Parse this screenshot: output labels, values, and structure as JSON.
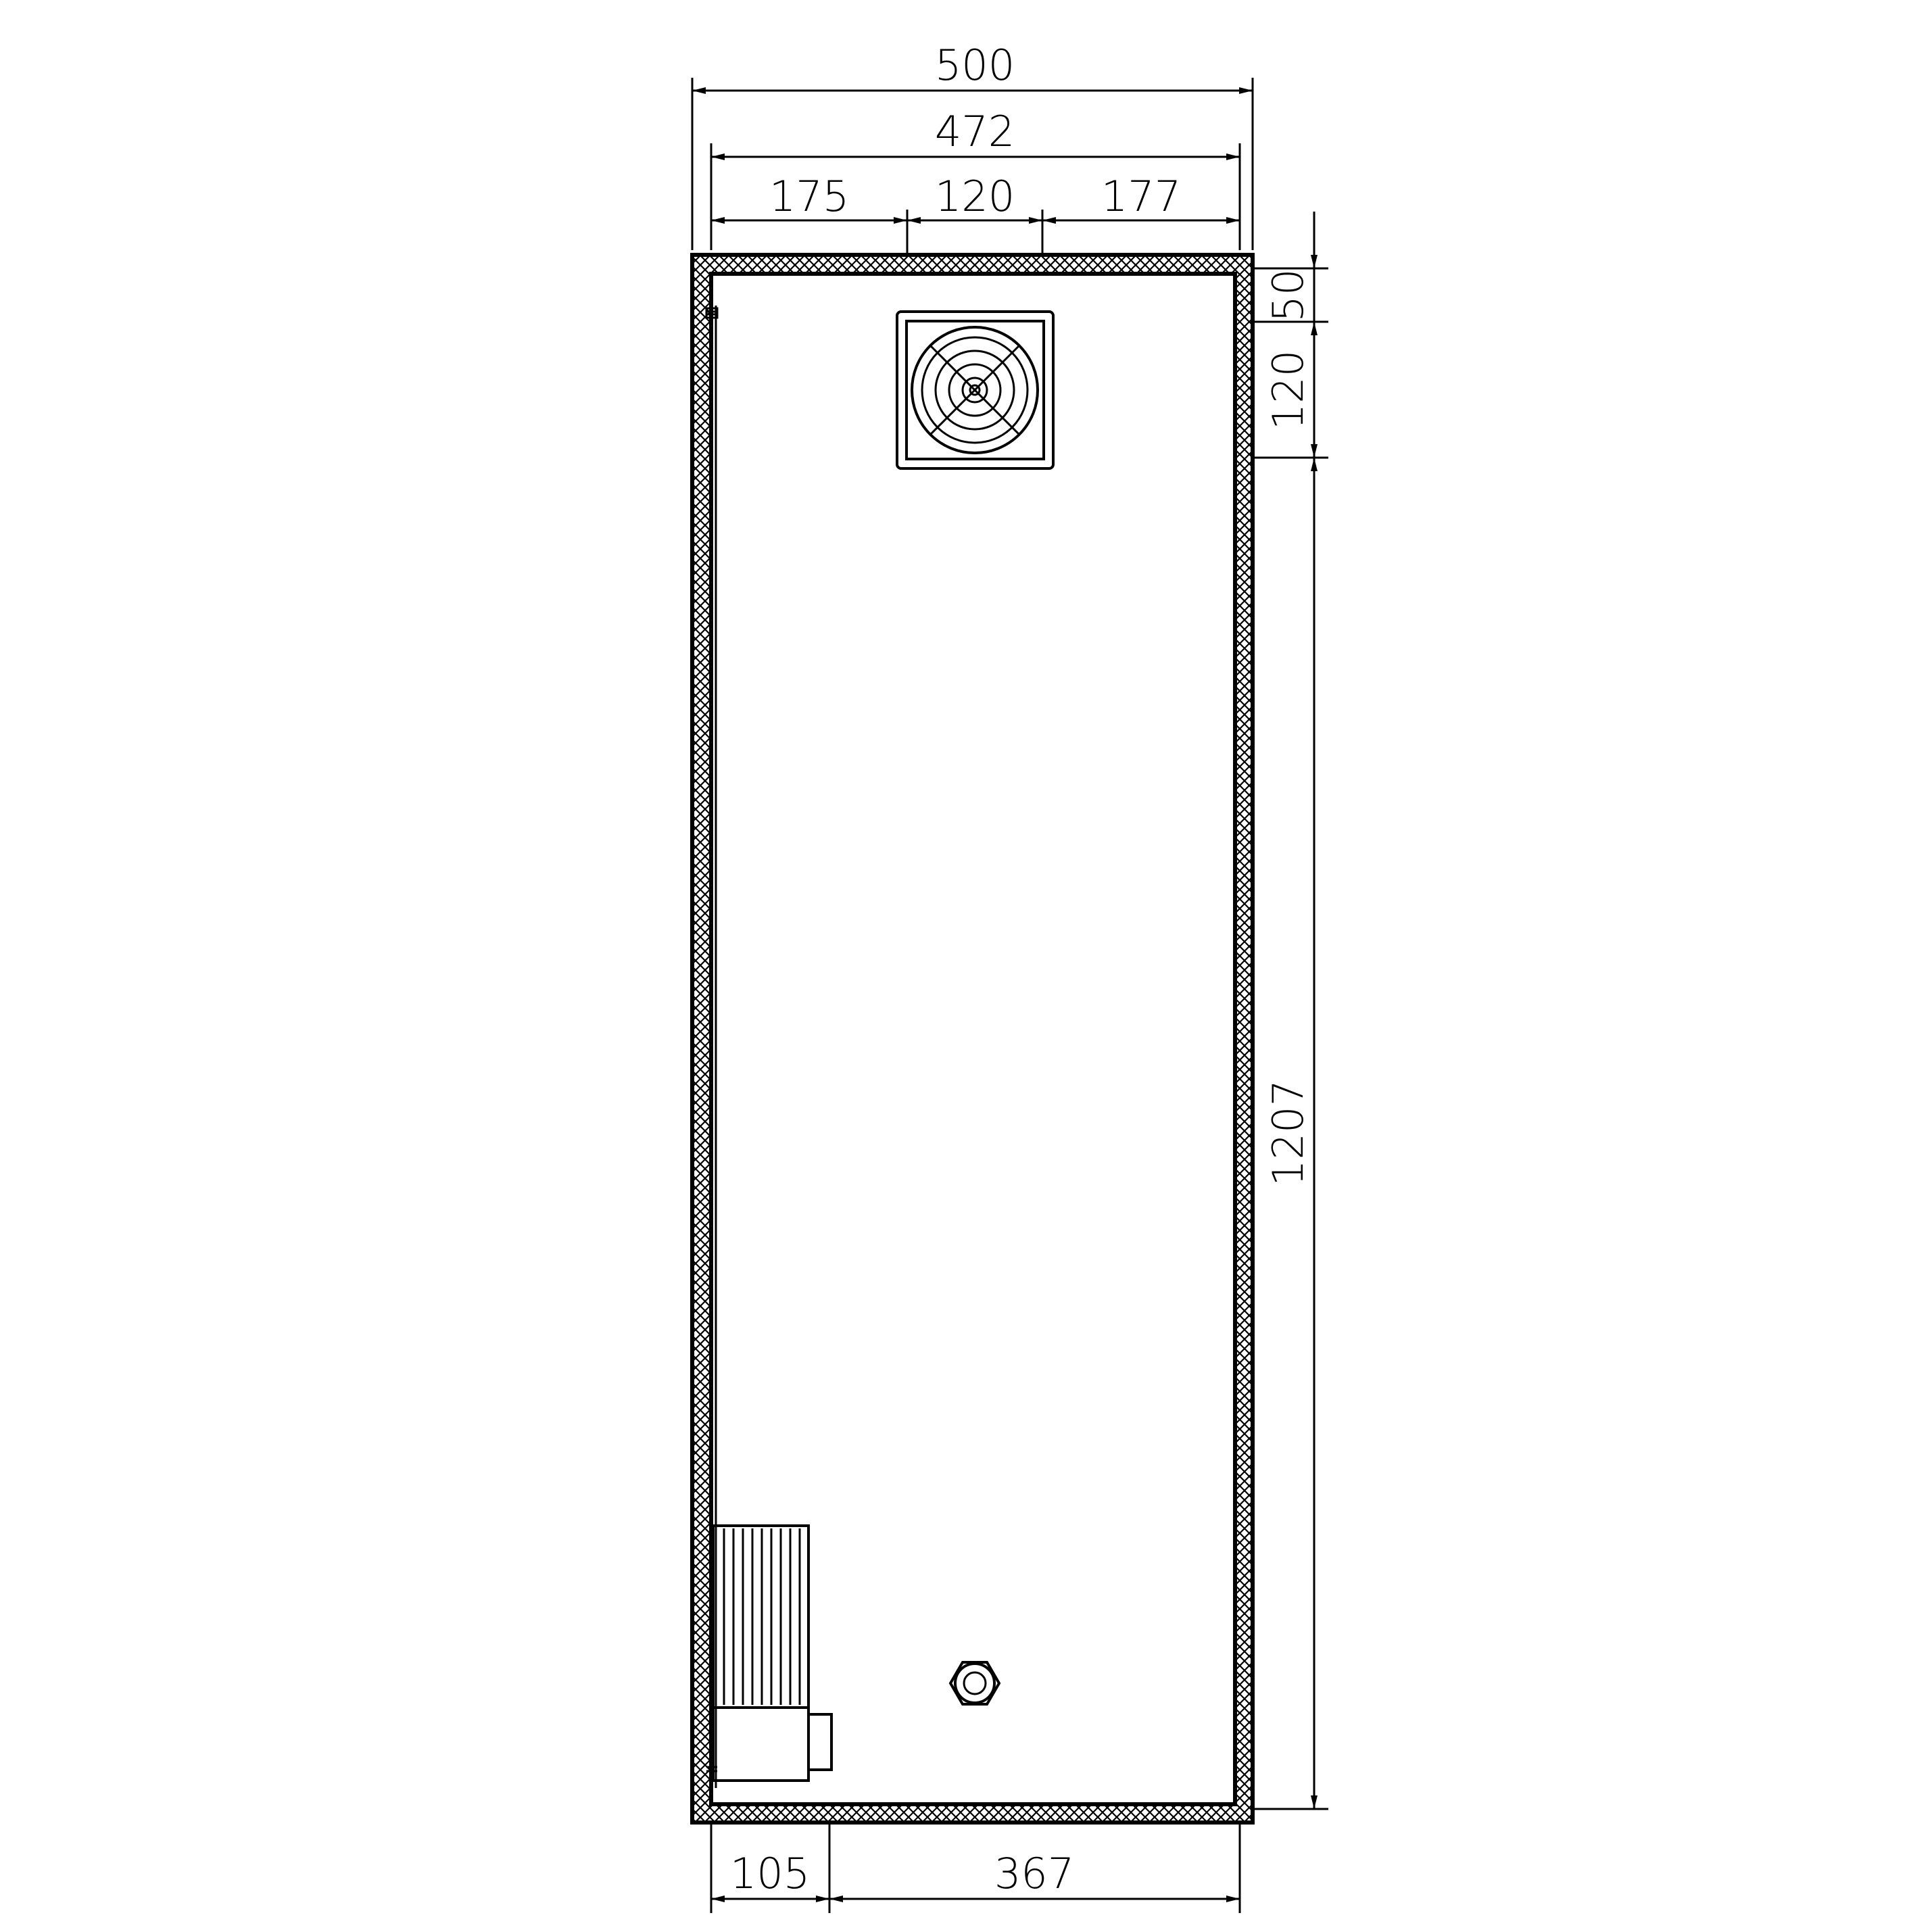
{
  "colors": {
    "line": "#000000",
    "background": "#ffffff"
  },
  "dimensions": {
    "overall_width": "500",
    "inner_width": "472",
    "left_offset": "175",
    "fan_width": "120",
    "right_offset": "177",
    "top_offset": "50",
    "fan_height": "120",
    "lower_height": "1207",
    "bottom_left": "105",
    "bottom_right": "367"
  },
  "components": {
    "fan": "fan-icon",
    "cable_gland": "cable-gland-icon",
    "heater": "heater-block-icon",
    "hinge": "hinge-icon"
  }
}
